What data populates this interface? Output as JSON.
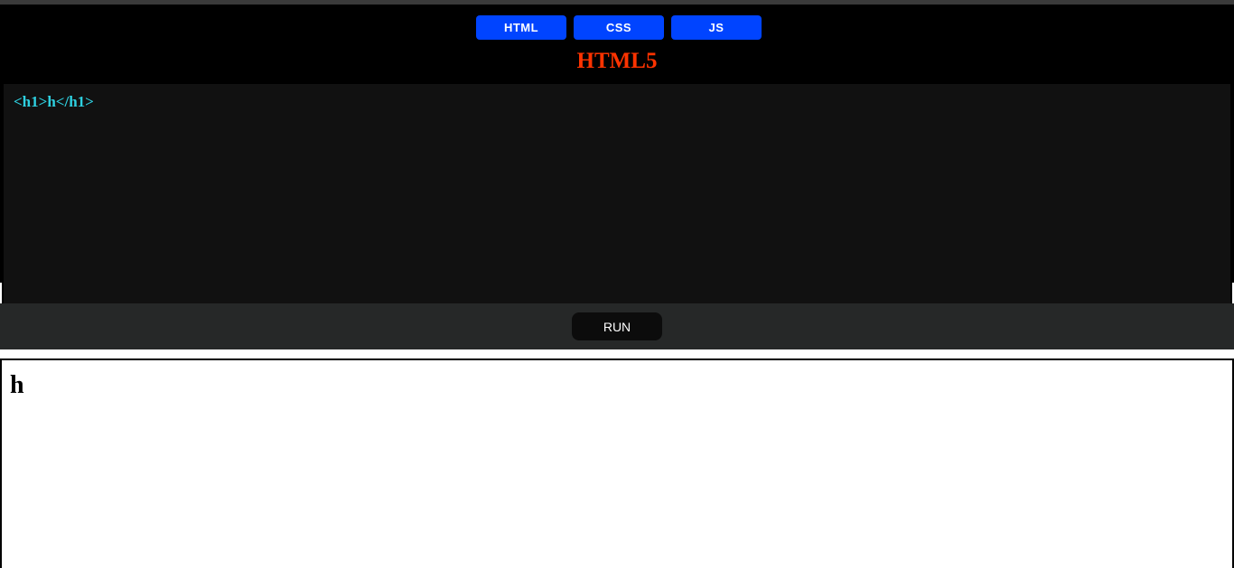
{
  "tabs": [
    {
      "label": "HTML"
    },
    {
      "label": "CSS"
    },
    {
      "label": "JS"
    }
  ],
  "editor": {
    "language_title": "HTML5",
    "code": "<h1>h</h1>"
  },
  "run_button": {
    "label": "RUN"
  },
  "output": {
    "heading": "h"
  },
  "colors": {
    "tab_bg": "#0044ff",
    "title": "#ff3300",
    "code_text": "#2ed0e0",
    "editor_bg": "#111111",
    "run_bar_bg": "#262828"
  }
}
